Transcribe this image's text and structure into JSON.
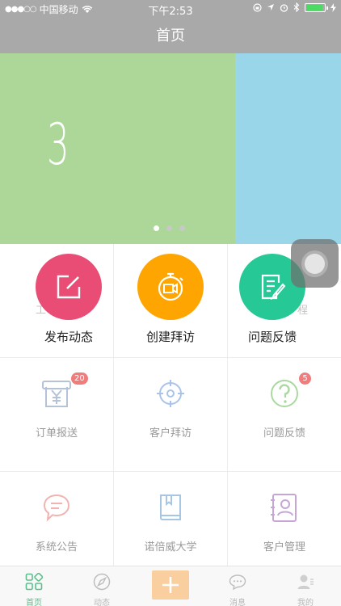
{
  "status_bar": {
    "carrier": "中国移动",
    "time": "下午2:53"
  },
  "nav": {
    "title": "首页"
  },
  "banner": {
    "slide_number": "3",
    "page_count": 3,
    "active_page": 1
  },
  "quick_actions": [
    {
      "label": "发布动态",
      "color": "#e94d76",
      "icon": "edit-icon"
    },
    {
      "label": "创建拜访",
      "color": "#fea501",
      "icon": "stopwatch-video-icon"
    },
    {
      "label": "问题反馈",
      "color": "#26c995",
      "icon": "document-pen-icon"
    }
  ],
  "ghost_text": {
    "left": "工",
    "right": "程"
  },
  "grid": [
    {
      "label": "订单报送",
      "icon": "yuan-receipt-icon",
      "badge": "20"
    },
    {
      "label": "客户拜访",
      "icon": "target-icon"
    },
    {
      "label": "问题反馈",
      "icon": "question-icon",
      "badge": "5"
    },
    {
      "label": "系统公告",
      "icon": "chat-bubble-icon"
    },
    {
      "label": "诺倍威大学",
      "icon": "book-icon"
    },
    {
      "label": "客户管理",
      "icon": "contacts-icon"
    }
  ],
  "tabs": [
    {
      "label": "首页",
      "icon": "grid-icon",
      "active": true
    },
    {
      "label": "动态",
      "icon": "compass-icon"
    },
    {
      "label": "",
      "icon": "plus-icon"
    },
    {
      "label": "消息",
      "icon": "message-icon"
    },
    {
      "label": "我的",
      "icon": "user-icon"
    }
  ],
  "colors": {
    "nav_bg": "#a9a9a9",
    "accent_green": "#5ac08b",
    "badge": "#f07d7d"
  }
}
